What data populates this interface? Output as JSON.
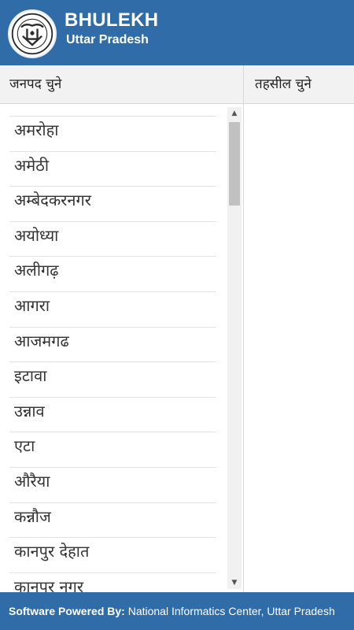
{
  "header": {
    "title": "BHULEKH",
    "subtitle": "Uttar Pradesh",
    "logo_icon": "up-government-emblem-icon"
  },
  "columns": {
    "district_header": "जनपद चुने",
    "tehsil_header": "तहसील चुने"
  },
  "districts": [
    "अमरोहा",
    "अमेठी",
    "अम्बेदकरनगर",
    "अयोध्या",
    "अलीगढ़",
    "आगरा",
    "आजमगढ",
    "इटावा",
    "उन्नाव",
    "एटा",
    "औरैया",
    "कन्नौज",
    "कानपुर देहात",
    "कानपुर नगर"
  ],
  "scrollbar": {
    "up_icon": "scroll-up-arrow-icon",
    "down_icon": "scroll-down-arrow-icon",
    "up_glyph": "▲",
    "down_glyph": "▼"
  },
  "footer": {
    "label": "Software Powered By:",
    "text": " National Informatics Center, Uttar Pradesh"
  },
  "colors": {
    "brand_blue": "#2f6ca8",
    "header_grey": "#f2f2f2"
  }
}
